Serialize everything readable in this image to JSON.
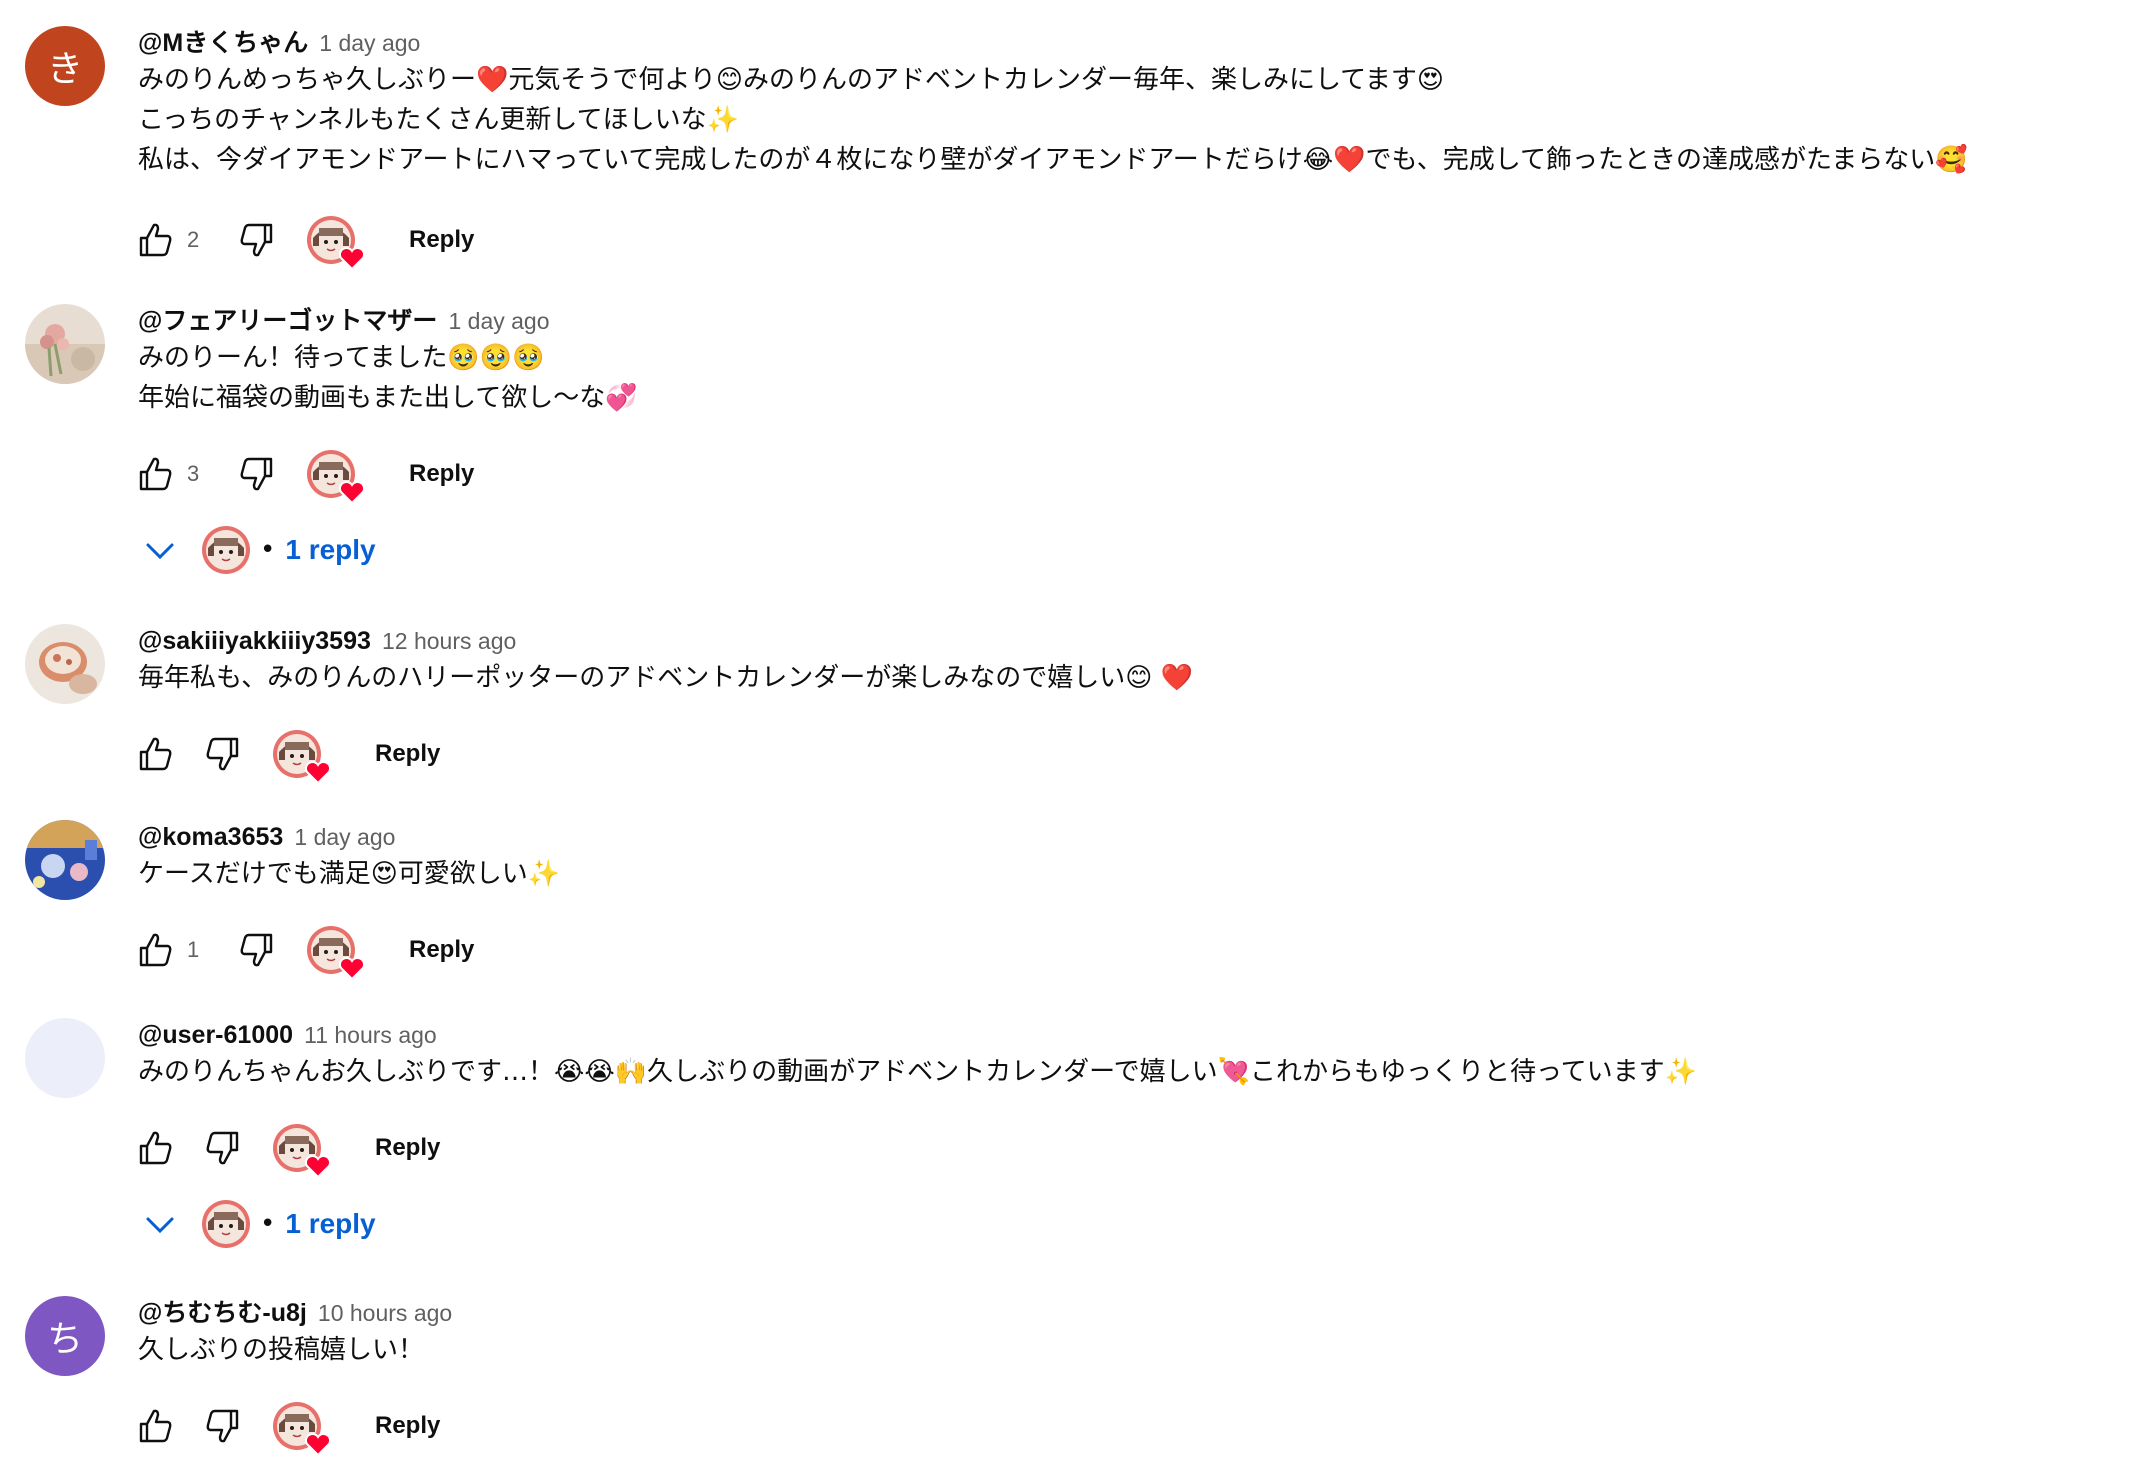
{
  "reply_label": "Reply",
  "comments": [
    {
      "author": "@Mきくちゃん",
      "time": "1 day ago",
      "avatar_letter": "き",
      "avatar_color": "#c0451f",
      "lines": [
        "みのりんめっちゃ久しぶりー❤️元気そうで何より😊みのりんのアドベントカレンダー毎年、楽しみにしてます😍",
        "こっちのチャンネルもたくさん更新してほしいな✨",
        "私は、今ダイアモンドアートにハマっていて完成したのが４枚になり壁がダイアモンドアートだらけ😂❤️でも、完成して飾ったときの達成感がたまらない🥰"
      ],
      "likes": "2"
    },
    {
      "author": "@フェアリーゴットマザー",
      "time": "1 day ago",
      "avatar_icon": "flower-photo",
      "lines": [
        "みのりーん！待ってました🥹🥹🥹",
        "年始に福袋の動画もまた出して欲し〜な💞"
      ],
      "likes": "3",
      "replies_label": "1 reply"
    },
    {
      "author": "@sakiiiyakkiiiy3593",
      "time": "12 hours ago",
      "avatar_icon": "food-photo",
      "lines": [
        "毎年私も、みのりんのハリーポッターのアドベントカレンダーが楽しみなので嬉しい😊 ❤️"
      ],
      "likes": ""
    },
    {
      "author": "@koma3653",
      "time": "1 day ago",
      "avatar_icon": "blue-photo",
      "lines": [
        "ケースだけでも満足😍可愛欲しい✨"
      ],
      "likes": "1"
    },
    {
      "author": "@user-61000",
      "time": "11 hours ago",
      "avatar_color": "#eceefa",
      "lines": [
        "みのりんちゃんお久しぶりです…！😭😭🙌久しぶりの動画がアドベントカレンダーで嬉しい💘これからもゆっくりと待っています✨"
      ],
      "likes": "",
      "replies_label": "1 reply"
    },
    {
      "author": "@ちむちむ-u8j",
      "time": "10 hours ago",
      "avatar_letter": "ち",
      "avatar_color": "#7e57c2",
      "lines": [
        "久しぶりの投稿嬉しい！"
      ],
      "likes": ""
    }
  ]
}
